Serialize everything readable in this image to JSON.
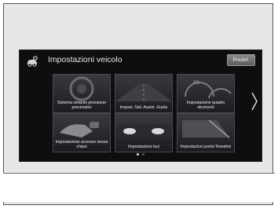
{
  "header": {
    "title": "Impostazioni veicolo",
    "default_button": "Predef."
  },
  "tiles": [
    {
      "label": "Sistema simbolo pressione pneumatici",
      "icon": "tire-pressure-icon"
    },
    {
      "label": "Impost. Sist. Assist. Guida",
      "icon": "driver-assist-icon"
    },
    {
      "label": "Impostazione quadro strumenti",
      "icon": "instrument-cluster-icon"
    },
    {
      "label": "Impostazione accesso senza chiavi",
      "icon": "keyless-access-icon"
    },
    {
      "label": "Impostazione luci",
      "icon": "headlights-icon"
    },
    {
      "label": "Impostazioni porte/ finestrini",
      "icon": "door-window-icon"
    }
  ],
  "pagination": {
    "current": 1,
    "total": 2
  },
  "colors": {
    "screen_bg": "#0e0e10",
    "tile_bg": "#2c2c30",
    "text": "#f0f0f0"
  }
}
